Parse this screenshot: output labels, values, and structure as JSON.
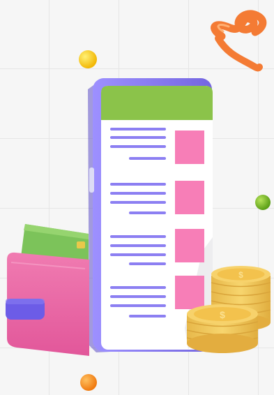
{
  "illustration": {
    "subject": "phone-list-wallet-coins",
    "icons": [
      "phone",
      "wallet",
      "credit-card",
      "coin-stack",
      "dollar-coin",
      "spring-coil",
      "ball"
    ],
    "colors": {
      "background": "#f6f6f6",
      "grid": "#e6e6e6",
      "phone_frame": "#8a7ff0",
      "phone_header": "#8bc34a",
      "list_line": "#8c7ff2",
      "list_thumb": "#f77eb7",
      "wallet": "#ec6aa5",
      "wallet_strap": "#6c5ce7",
      "card": "#7cc35a",
      "coin": "#f7d26b",
      "spring": "#f47b34",
      "ball_yellow": "#f5c518",
      "ball_green": "#7cc21f",
      "ball_orange": "#f7931e"
    },
    "list_rows": 4,
    "lines_per_row": 4
  }
}
